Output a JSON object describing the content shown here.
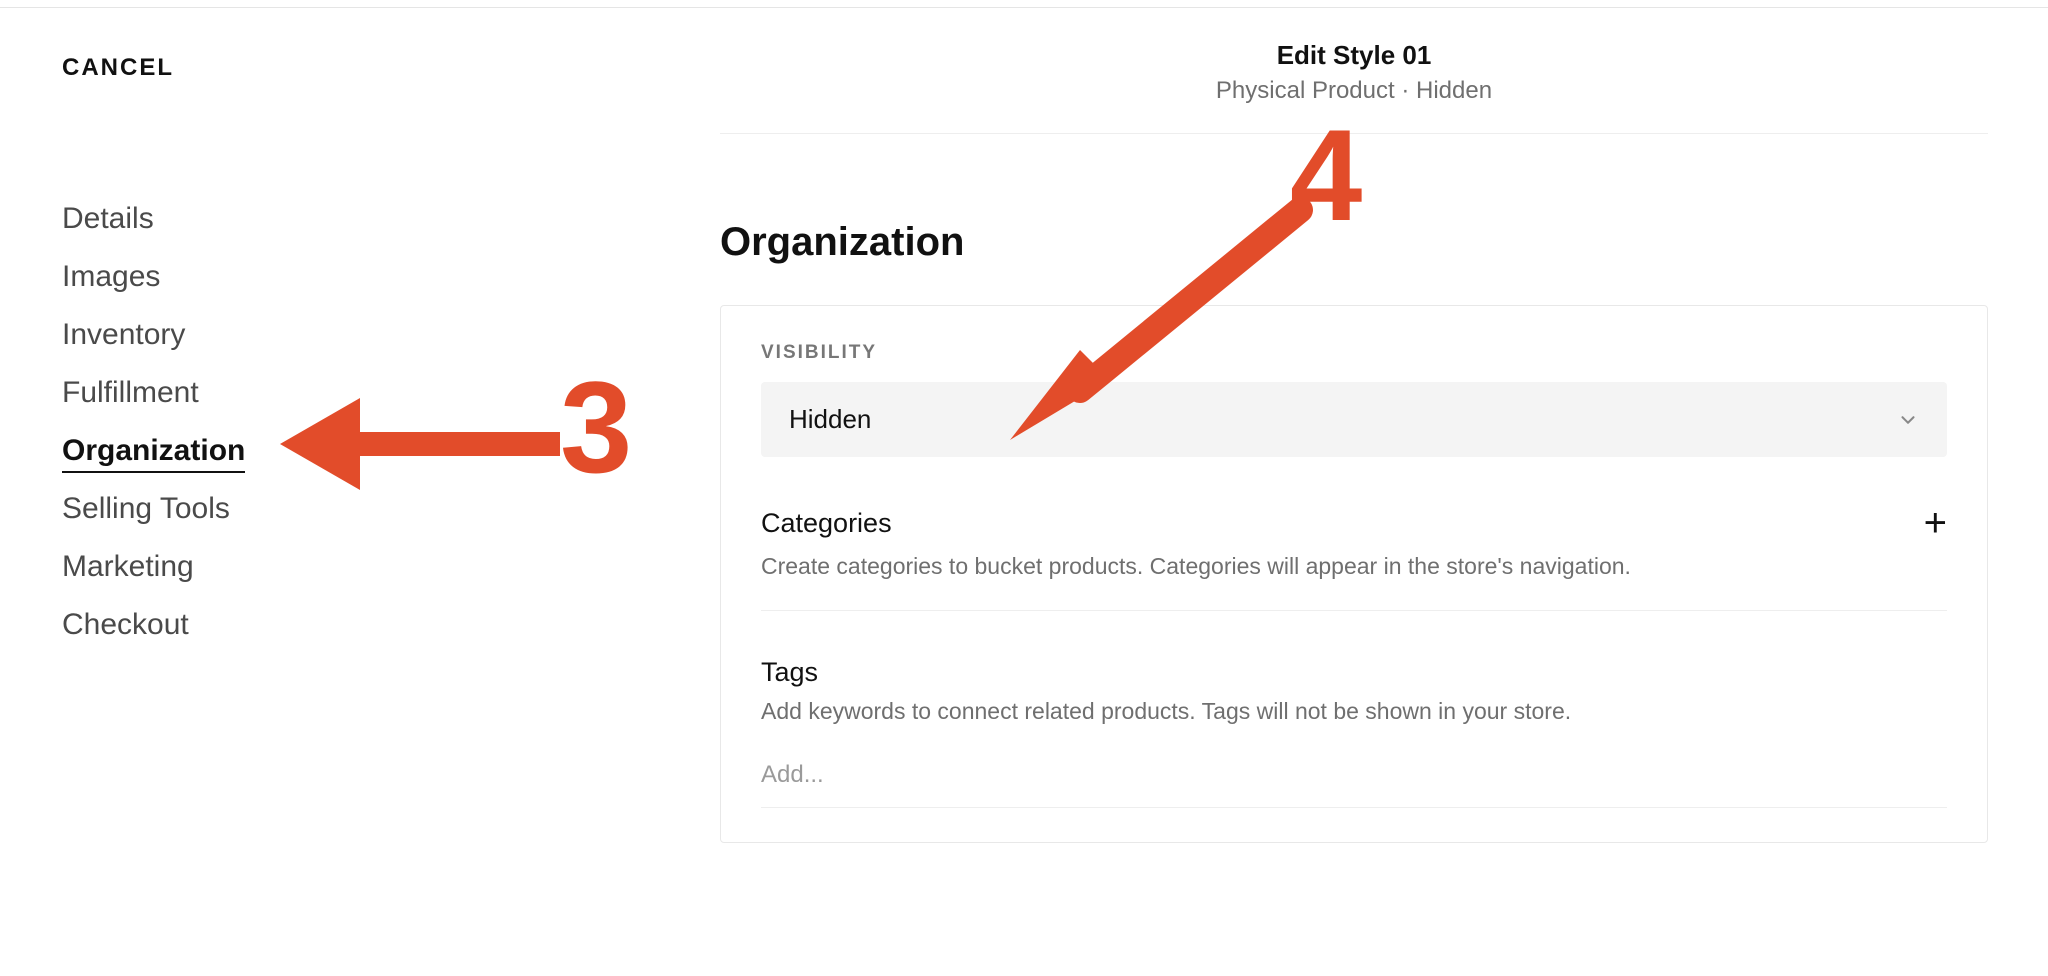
{
  "header": {
    "cancel": "CANCEL",
    "title": "Edit Style 01",
    "subtitle": "Physical Product · Hidden"
  },
  "sidebar": {
    "items": [
      {
        "label": "Details",
        "active": false
      },
      {
        "label": "Images",
        "active": false
      },
      {
        "label": "Inventory",
        "active": false
      },
      {
        "label": "Fulfillment",
        "active": false
      },
      {
        "label": "Organization",
        "active": true
      },
      {
        "label": "Selling Tools",
        "active": false
      },
      {
        "label": "Marketing",
        "active": false
      },
      {
        "label": "Checkout",
        "active": false
      }
    ]
  },
  "main": {
    "section_title": "Organization",
    "visibility": {
      "label": "VISIBILITY",
      "value": "Hidden"
    },
    "categories": {
      "title": "Categories",
      "desc": "Create categories to bucket products. Categories will appear in the store's navigation."
    },
    "tags": {
      "title": "Tags",
      "desc": "Add keywords to connect related products. Tags will not be shown in your store.",
      "placeholder": "Add..."
    }
  },
  "annotations": {
    "n3": "3",
    "n4": "4"
  }
}
